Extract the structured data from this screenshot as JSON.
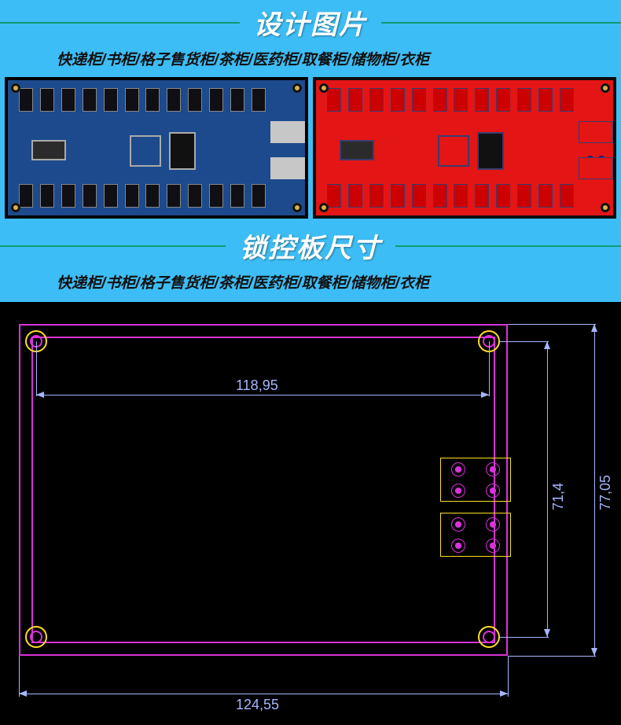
{
  "section1": {
    "title": "设计图片",
    "subtitle": "快递柜/书柜/格子售货柜/茶柜/医药柜/取餐柜/储物柜/衣柜"
  },
  "section2": {
    "title": "锁控板尺寸",
    "subtitle": "快递柜/书柜/格子售货柜/茶柜/医药柜/取餐柜/储物柜/衣柜"
  },
  "chart_data": {
    "type": "diagram",
    "description": "PCB mechanical outline with mounting holes and two 4-pin connector footprints",
    "dimensions_mm": {
      "outer_width": 124.55,
      "outer_height": 77.05,
      "mounting_hole_pitch_x": 118.95,
      "mounting_hole_pitch_y": 71.4
    },
    "labels": {
      "width_outer": "124,55",
      "height_outer": "77,05",
      "hole_pitch_x": "118,95",
      "hole_pitch_y": "71,4"
    }
  }
}
